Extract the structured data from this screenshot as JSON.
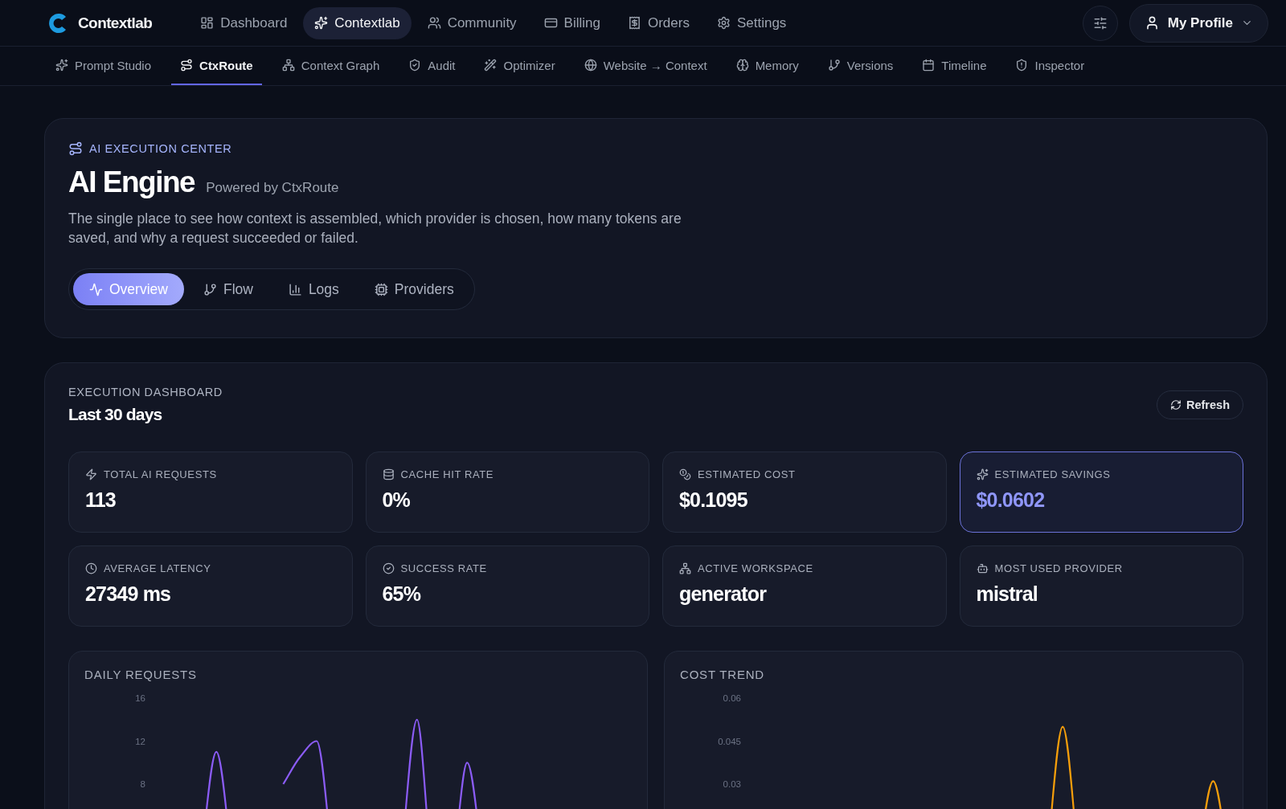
{
  "brand": {
    "name": "Contextlab"
  },
  "main_nav": [
    {
      "label": "Dashboard",
      "selected": false
    },
    {
      "label": "Contextlab",
      "selected": true
    },
    {
      "label": "Community",
      "selected": false
    },
    {
      "label": "Billing",
      "selected": false
    },
    {
      "label": "Orders",
      "selected": false
    },
    {
      "label": "Settings",
      "selected": false
    }
  ],
  "profile": {
    "label": "My Profile"
  },
  "sub_nav": [
    {
      "label": "Prompt Studio",
      "selected": false
    },
    {
      "label": "CtxRoute",
      "selected": true
    },
    {
      "label": "Context Graph",
      "selected": false
    },
    {
      "label": "Audit",
      "selected": false
    },
    {
      "label": "Optimizer",
      "selected": false
    },
    {
      "label": "Website → Context",
      "selected": false
    },
    {
      "label": "Memory",
      "selected": false
    },
    {
      "label": "Versions",
      "selected": false
    },
    {
      "label": "Timeline",
      "selected": false
    },
    {
      "label": "Inspector",
      "selected": false
    }
  ],
  "header": {
    "eyebrow": "AI EXECUTION CENTER",
    "title": "AI Engine",
    "subtitle": "Powered by CtxRoute",
    "description": "The single place to see how context is assembled, which provider is chosen, how many tokens are saved, and why a request succeeded or failed.",
    "tabs": [
      {
        "label": "Overview",
        "selected": true
      },
      {
        "label": "Flow",
        "selected": false
      },
      {
        "label": "Logs",
        "selected": false
      },
      {
        "label": "Providers",
        "selected": false
      }
    ]
  },
  "dashboard": {
    "eyebrow": "EXECUTION DASHBOARD",
    "title": "Last 30 days",
    "refresh": "Refresh",
    "stats": [
      {
        "label": "TOTAL AI REQUESTS",
        "value": "113",
        "highlighted": false
      },
      {
        "label": "CACHE HIT RATE",
        "value": "0%",
        "highlighted": false
      },
      {
        "label": "ESTIMATED COST",
        "value": "$0.1095",
        "highlighted": false
      },
      {
        "label": "ESTIMATED SAVINGS",
        "value": "$0.0602",
        "highlighted": true
      },
      {
        "label": "AVERAGE LATENCY",
        "value": "27349 ms",
        "highlighted": false
      },
      {
        "label": "SUCCESS RATE",
        "value": "65%",
        "highlighted": false
      },
      {
        "label": "ACTIVE WORKSPACE",
        "value": "generator",
        "highlighted": false
      },
      {
        "label": "MOST USED PROVIDER",
        "value": "mistral",
        "highlighted": false
      }
    ],
    "charts": [
      {
        "title": "DAILY REQUESTS",
        "kind": "requests",
        "y_axis_labels": [
          "16",
          "12",
          "8"
        ]
      },
      {
        "title": "COST TREND",
        "kind": "cost",
        "y_axis_labels": [
          "0.06",
          "0.045",
          "0.03"
        ]
      }
    ]
  }
}
